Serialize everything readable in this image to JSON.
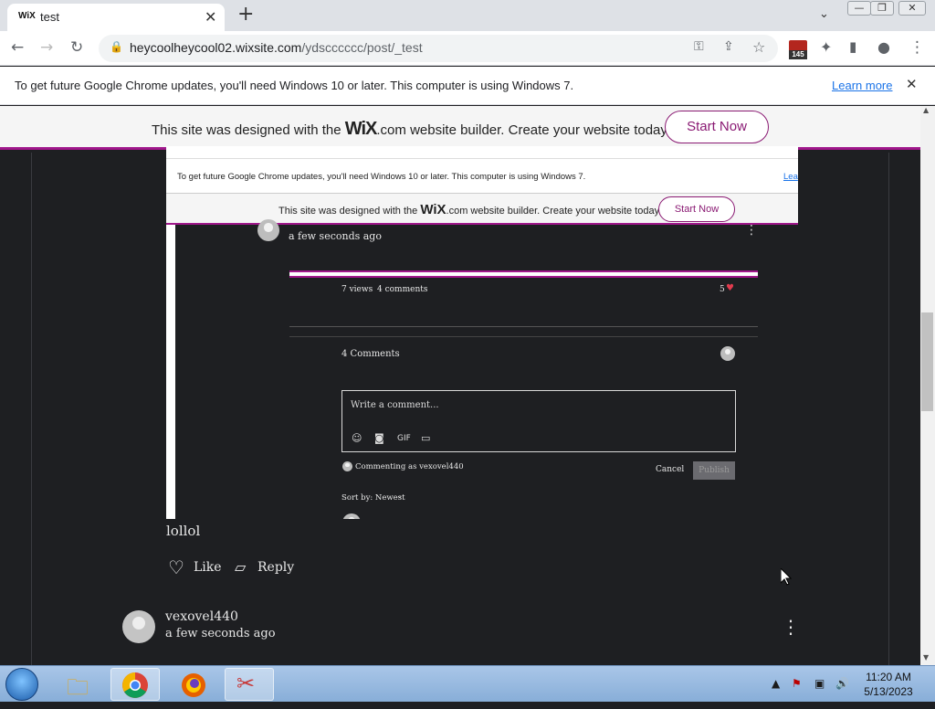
{
  "browser": {
    "tab_favicon": "WiX",
    "tab_title": "test",
    "tab_close": "✕",
    "new_tab": "+",
    "url_host": "heycoolheycool02.wixsite.com",
    "url_path": "/ydscccccc/post/_test",
    "extension_badge": "145"
  },
  "infobar": {
    "message": "To get future Google Chrome updates, you'll need Windows 10 or later. This computer is using Windows 7.",
    "link": "Learn more"
  },
  "wix_banner": {
    "prefix": "This site was designed with the ",
    "brand": "WiX",
    "suffix": ".com website builder. Create your website today.",
    "button": "Start Now"
  },
  "embedded": {
    "infobar_message": "To get future Google Chrome updates, you'll need Windows 10 or later. This computer is using Windows 7.",
    "infobar_link": "Lea",
    "wix_prefix": "This site was designed with the ",
    "wix_brand": "WiX",
    "wix_suffix": ".com website builder. Create your website today.",
    "wix_button": "Start Now",
    "comment_time": "a few seconds ago",
    "views": "7 views",
    "comments_count": "4 comments",
    "likes": "5",
    "comments_heading": "4 Comments",
    "placeholder": "Write a comment...",
    "gif_label": "GIF",
    "commenting_as": "Commenting as vexovel440",
    "cancel": "Cancel",
    "publish": "Publish",
    "sort_by": "Sort by: Newest"
  },
  "comment": {
    "text": "lollol",
    "like": "Like",
    "reply": "Reply"
  },
  "next_comment": {
    "author": "vexovel440",
    "time": "a few seconds ago"
  },
  "taskbar": {
    "time": "11:20 AM",
    "date": "5/13/2023"
  }
}
